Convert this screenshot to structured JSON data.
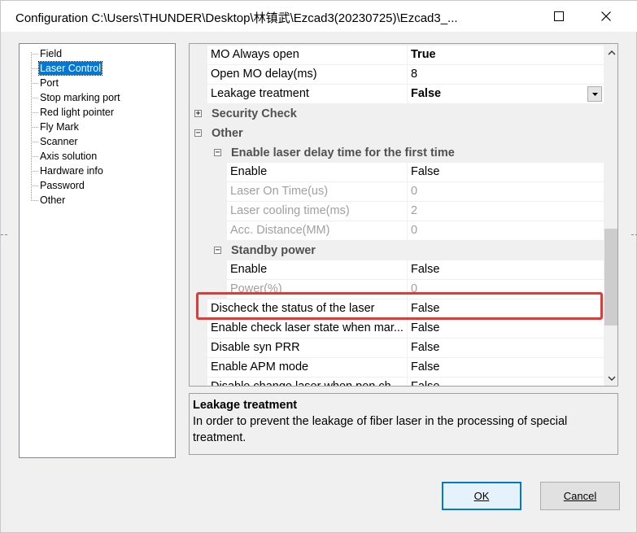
{
  "window": {
    "title": "Configuration C:\\Users\\THUNDER\\Desktop\\林镇武\\Ezcad3(20230725)\\Ezcad3_..."
  },
  "tree": {
    "items": [
      {
        "label": "Field",
        "selected": false
      },
      {
        "label": "Laser Control",
        "selected": true
      },
      {
        "label": "Port",
        "selected": false
      },
      {
        "label": "Stop marking port",
        "selected": false
      },
      {
        "label": "Red light pointer",
        "selected": false
      },
      {
        "label": "Fly Mark",
        "selected": false
      },
      {
        "label": "Scanner",
        "selected": false
      },
      {
        "label": "Axis solution",
        "selected": false
      },
      {
        "label": "Hardware info",
        "selected": false
      },
      {
        "label": "Password",
        "selected": false
      },
      {
        "label": "Other",
        "selected": false
      }
    ]
  },
  "grid": {
    "rows": [
      {
        "kind": "prop",
        "indent": 1,
        "name": "MO Always open",
        "value": "True",
        "bold_value": true,
        "disabled": false
      },
      {
        "kind": "prop",
        "indent": 1,
        "name": "Open MO delay(ms)",
        "value": "8",
        "bold_value": false,
        "disabled": false
      },
      {
        "kind": "prop",
        "indent": 1,
        "name": "Leakage treatment",
        "value": "False",
        "bold_value": true,
        "disabled": false,
        "dropdown": true
      },
      {
        "kind": "cat",
        "indent": 0,
        "name": "Security Check",
        "expander": "+"
      },
      {
        "kind": "cat",
        "indent": 0,
        "name": "Other",
        "expander": "−"
      },
      {
        "kind": "cat",
        "indent": 1,
        "name": "Enable laser delay time for the first time",
        "expander": "−"
      },
      {
        "kind": "prop",
        "indent": 2,
        "name": "Enable",
        "value": "False",
        "bold_value": false,
        "disabled": false
      },
      {
        "kind": "prop",
        "indent": 2,
        "name": "Laser On Time(us)",
        "value": "0",
        "bold_value": false,
        "disabled": true
      },
      {
        "kind": "prop",
        "indent": 2,
        "name": "Laser cooling time(ms)",
        "value": "2",
        "bold_value": false,
        "disabled": true
      },
      {
        "kind": "prop",
        "indent": 2,
        "name": "Acc. Distance(MM)",
        "value": "0",
        "bold_value": false,
        "disabled": true
      },
      {
        "kind": "cat",
        "indent": 1,
        "name": "Standby power",
        "expander": "−"
      },
      {
        "kind": "prop",
        "indent": 2,
        "name": "Enable",
        "value": "False",
        "bold_value": false,
        "disabled": false
      },
      {
        "kind": "prop",
        "indent": 2,
        "name": "Power(%)",
        "value": "0",
        "bold_value": false,
        "disabled": true
      },
      {
        "kind": "prop",
        "indent": 1,
        "name": "Discheck the status of the laser",
        "value": "False",
        "bold_value": false,
        "disabled": false
      },
      {
        "kind": "prop",
        "indent": 1,
        "name": "Enable check laser state when mar...",
        "value": "False",
        "bold_value": false,
        "disabled": false
      },
      {
        "kind": "prop",
        "indent": 1,
        "name": "Disable syn PRR",
        "value": "False",
        "bold_value": false,
        "disabled": false
      },
      {
        "kind": "prop",
        "indent": 1,
        "name": "Enable APM mode",
        "value": "False",
        "bold_value": false,
        "disabled": false
      },
      {
        "kind": "prop",
        "indent": 1,
        "name": "Disable change laser when pen ch...",
        "value": "False",
        "bold_value": false,
        "disabled": false
      }
    ]
  },
  "description": {
    "title": "Leakage treatment",
    "text": "In order to prevent the leakage of fiber laser in the processing of special treatment."
  },
  "buttons": {
    "ok_label": "OK",
    "cancel_label": "Cancel"
  },
  "colors": {
    "selection": "#0078d7",
    "highlight_box": "#e53935"
  }
}
